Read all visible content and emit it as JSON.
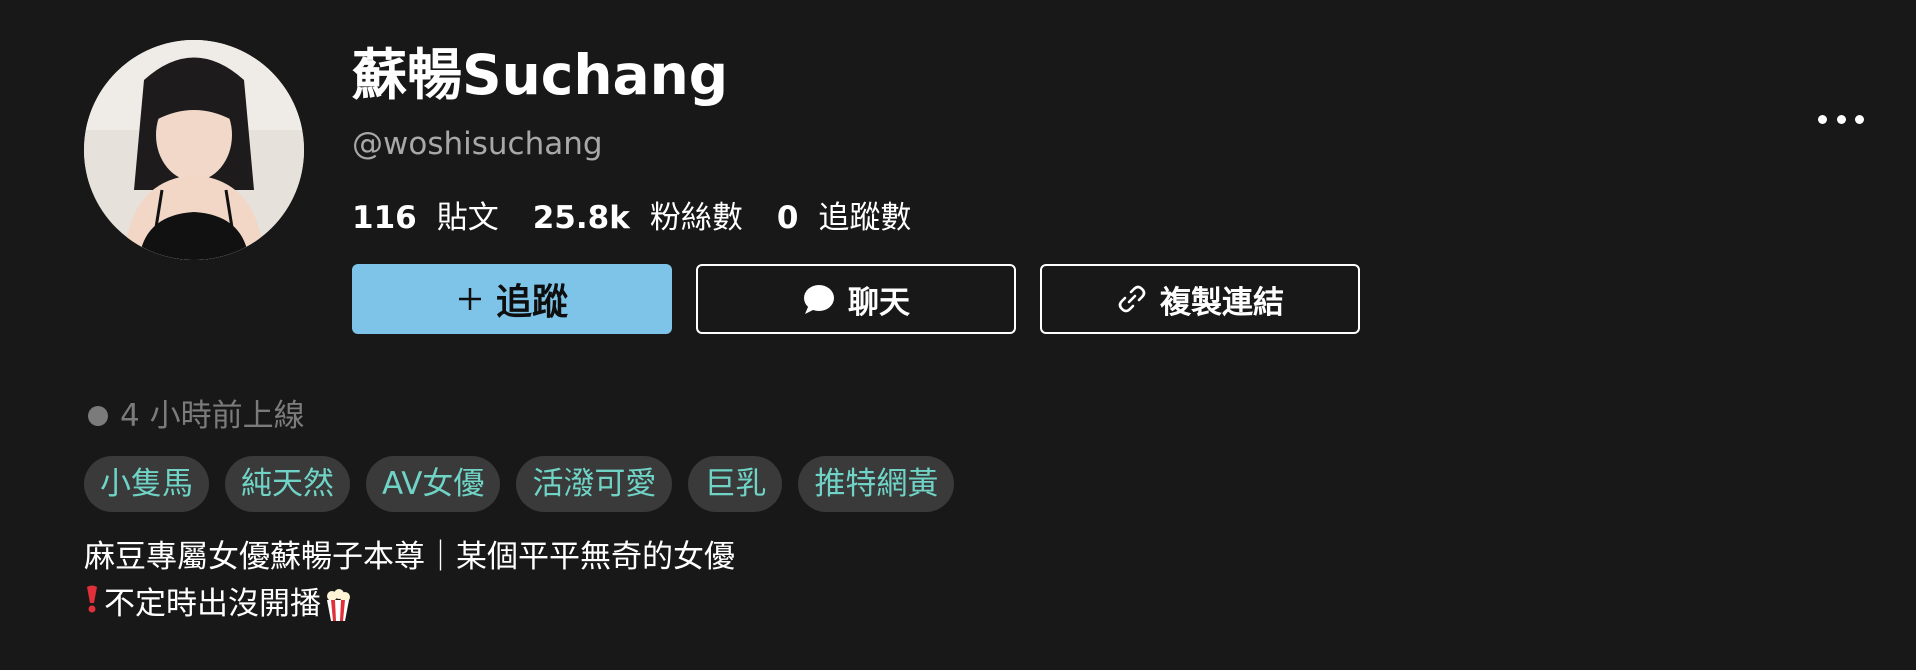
{
  "profile": {
    "display_name": "蘇暢Suchang",
    "handle": "@woshisuchang",
    "online_status": "4 小時前上線"
  },
  "stats": [
    {
      "value": "116",
      "label": "貼文"
    },
    {
      "value": "25.8k",
      "label": "粉絲數"
    },
    {
      "value": "0",
      "label": "追蹤數"
    }
  ],
  "actions": {
    "follow_label": "追蹤",
    "chat_label": "聊天",
    "copy_link_label": "複製連結"
  },
  "tags": [
    "小隻馬",
    "純天然",
    "AV女優",
    "活潑可愛",
    "巨乳",
    "推特網黃"
  ],
  "bio": {
    "line1": "麻豆專屬女優蘇暢子本尊｜某個平平無奇的女優",
    "line2": "不定時出沒開播"
  },
  "icons": {
    "more": "more-horizontal-icon",
    "follow": "plus-icon",
    "chat": "chat-bubble-icon",
    "copy": "link-icon",
    "bio_prefix": "exclamation-icon",
    "bio_suffix": "popcorn-icon"
  },
  "colors": {
    "background": "#181818",
    "accent": "#7ec3e8",
    "tag_text": "#6fd3c6",
    "tag_bg": "#3a3a3a",
    "muted": "#a8a8a8"
  }
}
